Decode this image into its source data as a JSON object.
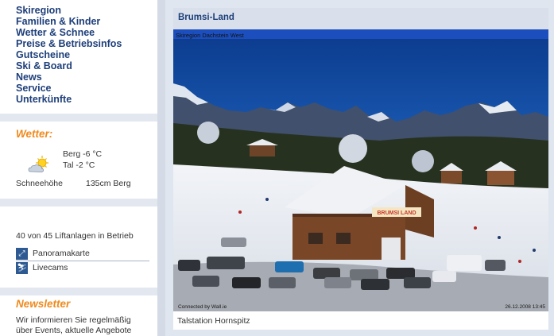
{
  "nav": {
    "items": [
      {
        "label": "Skiregion"
      },
      {
        "label": "Familien & Kinder"
      },
      {
        "label": "Wetter & Schnee"
      },
      {
        "label": "Preise & Betriebsinfos"
      },
      {
        "label": "Gutscheine"
      },
      {
        "label": "Ski & Board"
      },
      {
        "label": "News"
      },
      {
        "label": "Service"
      },
      {
        "label": "Unterkünfte"
      }
    ]
  },
  "weather": {
    "title": "Wetter:",
    "icon": "sun-cloud-icon",
    "berg": "Berg -6 °C",
    "tal": "Tal -2 °C",
    "snow_label": "Schneehöhe",
    "snow_value": "135cm Berg"
  },
  "lifts": {
    "status": "40 von 45 Liftanlagen in Betrieb",
    "links": [
      {
        "label": "Panoramakarte",
        "icon": "panorama-map-icon"
      },
      {
        "label": "Livecams",
        "icon": "livecam-icon"
      }
    ]
  },
  "newsletter": {
    "title": "Newsletter",
    "text_line1": "Wir informieren Sie regelmäßig",
    "text_line2": "über Events, aktuelle Angebote"
  },
  "webcam": {
    "title": "Brumsi-Land",
    "overlay_top": "Skiregion Dachstein West",
    "overlay_bottom_left": "Connected by Wall.ie",
    "overlay_bottom_right": "26.12.2008 13:45",
    "sign_text": "BRUMSI LAND",
    "caption": "Talstation Hornspitz"
  }
}
